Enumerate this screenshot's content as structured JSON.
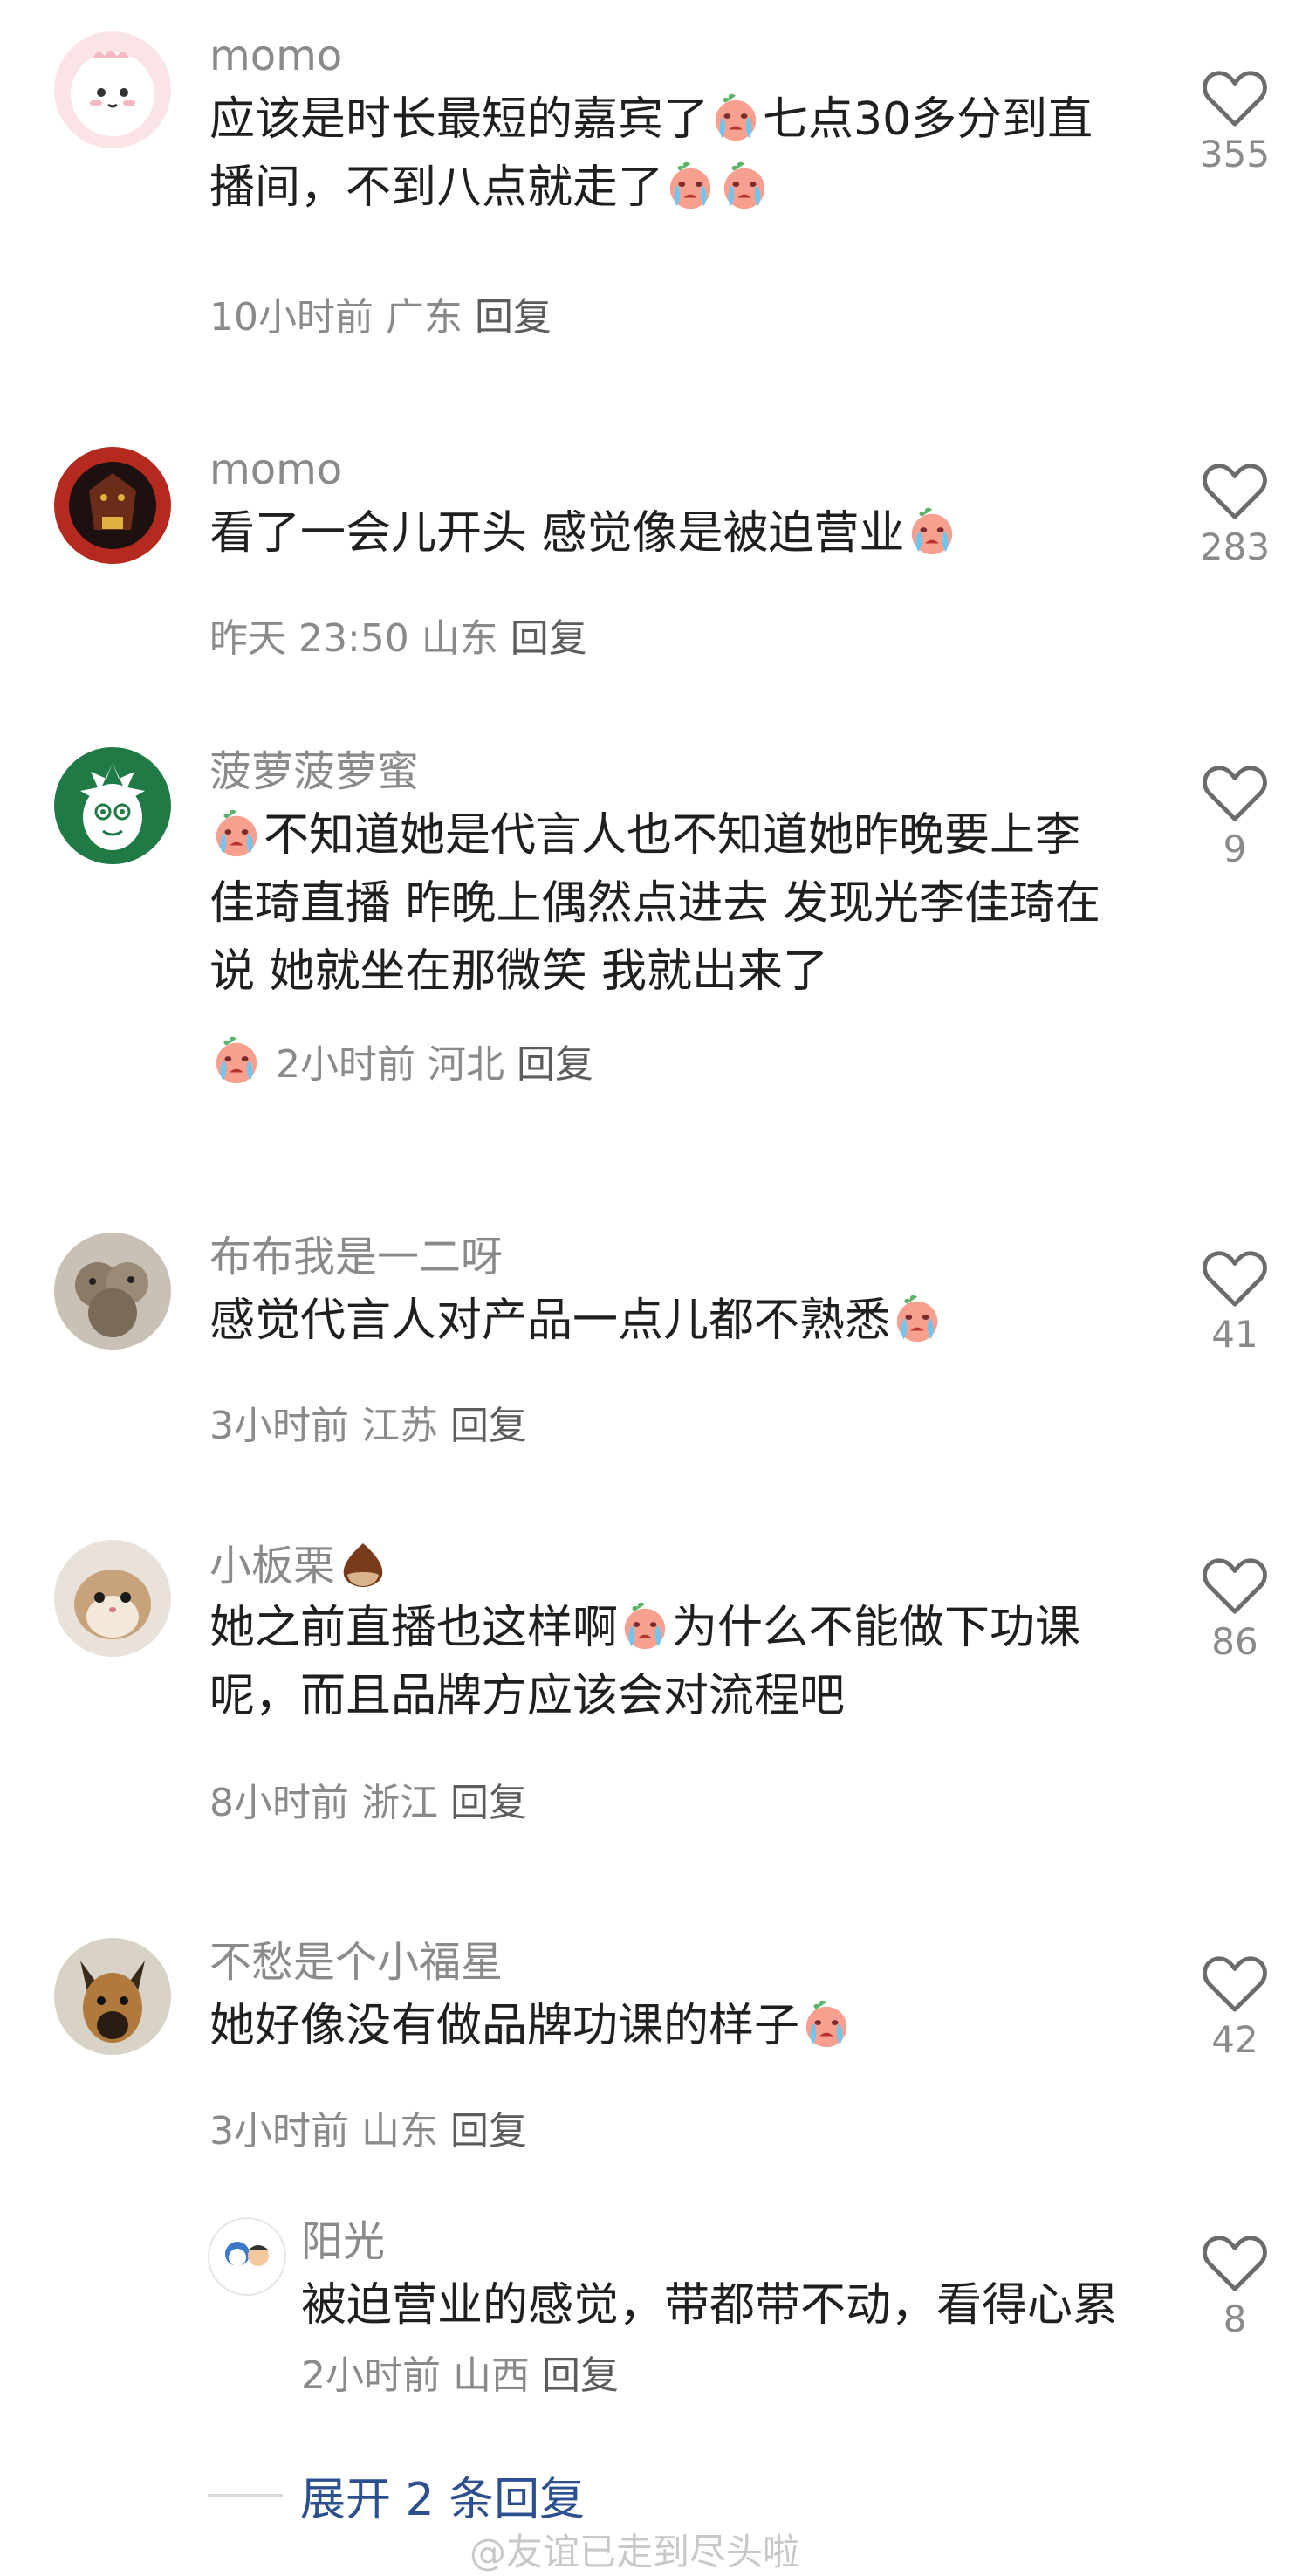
{
  "comments": [
    {
      "username": "momo",
      "content_a": "应该是时长最短的嘉宾了",
      "content_b": "七点30多分到直播间，不到八点就走了",
      "time": "10小时前",
      "location": "广东",
      "reply_label": "回复",
      "likes": "355",
      "avatar_icon": "pink-cat-avatar"
    },
    {
      "username": "momo",
      "content_a": "看了一会儿开头 感觉像是被迫营业",
      "time": "昨天 23:50",
      "location": "山东",
      "reply_label": "回复",
      "likes": "283",
      "avatar_icon": "red-warrior-avatar"
    },
    {
      "username": "菠萝菠萝蜜",
      "content_a": "不知道她是代言人也不知道她昨晚要上李佳琦直播 昨晚上偶然点进去 发现光李佳琦在说 她就坐在那微笑 我就出来了",
      "time": "2小时前",
      "location": "河北",
      "reply_label": "回复",
      "likes": "9",
      "avatar_icon": "green-mermaid-avatar"
    },
    {
      "username": "布布我是一二呀",
      "content_a": "感觉代言人对产品一点儿都不熟悉",
      "time": "3小时前",
      "location": "江苏",
      "reply_label": "回复",
      "likes": "41",
      "avatar_icon": "bear-photo-avatar"
    },
    {
      "username": "小板栗",
      "content_a": "她之前直播也这样啊",
      "content_b": "为什么不能做下功课呢，而且品牌方应该会对流程吧",
      "time": "8小时前",
      "location": "浙江",
      "reply_label": "回复",
      "likes": "86",
      "avatar_icon": "hamster-avatar"
    },
    {
      "username": "不愁是个小福星",
      "content_a": "她好像没有做品牌功课的样子",
      "time": "3小时前",
      "location": "山东",
      "reply_label": "回复",
      "likes": "42",
      "avatar_icon": "dog-avatar"
    }
  ],
  "reply": {
    "username": "阳光",
    "content_a": "被迫营业的感觉，带都带不动，看得心累",
    "time": "2小时前",
    "location": "山西",
    "reply_label": "回复",
    "likes": "8",
    "avatar_icon": "cartoon-avatar"
  },
  "expand_label": "展开 2 条回复",
  "watermark": "@友谊已走到尽头啦",
  "colors": {
    "secondary_text": "#8a8a8a",
    "link": "#2c4f8f",
    "emoji_face": "#f59e8b"
  }
}
